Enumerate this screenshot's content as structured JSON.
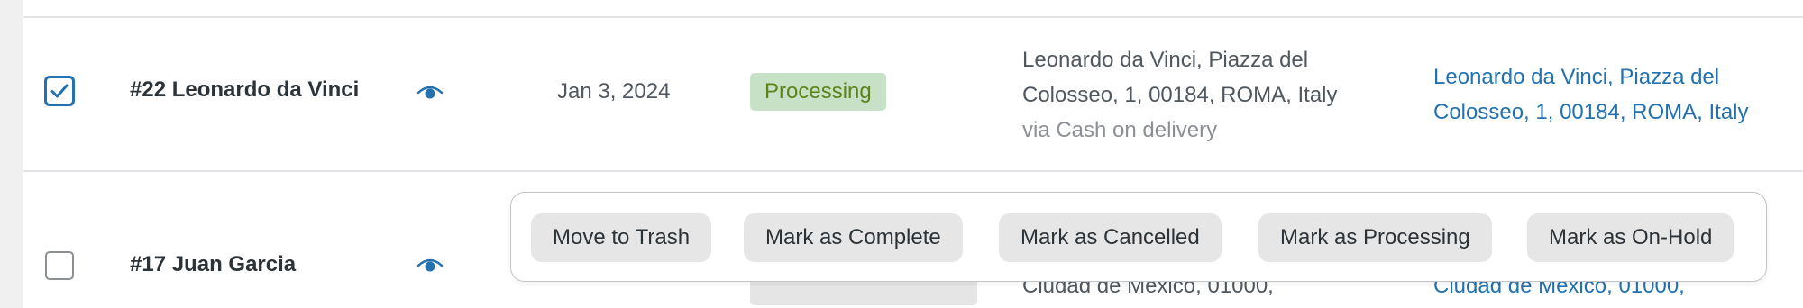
{
  "orders": [
    {
      "selected": true,
      "title": "#22 Leonardo da Vinci",
      "date": "Jan 3, 2024",
      "status": "Processing",
      "billing_line1": "Leonardo da Vinci, Piazza del",
      "billing_line2": "Colosseo, 1, 00184, ROMA, Italy",
      "payment_method": "via Cash on delivery",
      "shipping_line1": "Leonardo da Vinci, Piazza del",
      "shipping_line2": "Colosseo, 1, 00184, ROMA, Italy"
    },
    {
      "selected": false,
      "title": "#17 Juan Garcia",
      "billing_partial": "Ciudad de México, 01000,",
      "shipping_partial": "Ciudad de México, 01000,"
    }
  ],
  "bulk_actions": {
    "move_to_trash": "Move to Trash",
    "mark_complete": "Mark as Complete",
    "mark_cancelled": "Mark as Cancelled",
    "mark_processing": "Mark as Processing",
    "mark_on_hold": "Mark as On-Hold"
  },
  "colors": {
    "accent": "#2271b1",
    "processing_badge_bg": "#c6e1c6",
    "processing_badge_text": "#5b841b"
  },
  "icons": {
    "checkbox_checked": "checkmark-icon",
    "preview": "eye-icon"
  }
}
